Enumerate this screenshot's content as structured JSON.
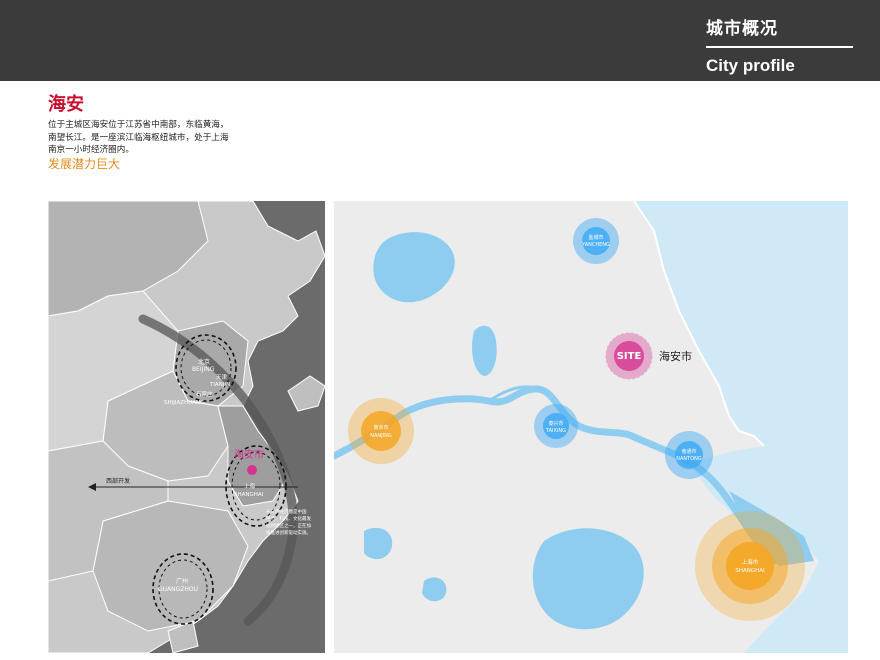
{
  "header": {
    "title_cn": "城市概况",
    "title_en": "City profile"
  },
  "section": {
    "title": "海安",
    "description_lines": [
      "位于主城区海安位于江苏省中南部，东临黄海，",
      "南望长江。是一座滨江临海枢纽城市，处于上海",
      "南京一小时经济圈内。"
    ],
    "highlight": "发展潜力巨大"
  },
  "left_map": {
    "labels": {
      "beijing_cn": "北京",
      "beijing_en": "BEIJING",
      "tianjin_cn": "天津",
      "tianjin_en": "TIANJIN",
      "shijiazhuang_cn": "石家庄",
      "shijiazhuang_en": "SHIJIAZHUANG",
      "haian_cn": "海安市",
      "shanghai_cn": "上海",
      "shanghai_en": "SHANGHAI",
      "guangzhou_cn": "广州",
      "guangzhou_en": "GUANGZHOU",
      "west_dev": "西部开发",
      "note_lines": [
        "长三角经济圈是中国",
        "经济、科技、文化最发",
        "达的地区之一，正在加",
        "快推进创新驱动实施。"
      ]
    },
    "colors": {
      "sea": "#6b6b6b",
      "land_light": "#c9c9c9",
      "land_mid": "#a9a9a9",
      "land_dark": "#8c8c8c",
      "haian_marker": "#d6338f"
    }
  },
  "right_map": {
    "cities": [
      {
        "cn": "盐城市",
        "en": "YANCHENG",
        "color": "#3fa9f5"
      },
      {
        "cn": "泰兴市",
        "en": "TAIXING",
        "color": "#3fa9f5"
      },
      {
        "cn": "南通市",
        "en": "NANTONG",
        "color": "#3fa9f5"
      },
      {
        "cn": "南京市",
        "en": "NANJING",
        "color": "#f5a623"
      },
      {
        "cn": "上海市",
        "en": "SHANGHAI",
        "color": "#f5a623"
      }
    ],
    "site": {
      "label": "SITE",
      "name": "海安市",
      "color": "#d6338f"
    },
    "colors": {
      "sea": "#cfe9f7",
      "land": "#ececec",
      "water": "#8fcdf0"
    }
  }
}
